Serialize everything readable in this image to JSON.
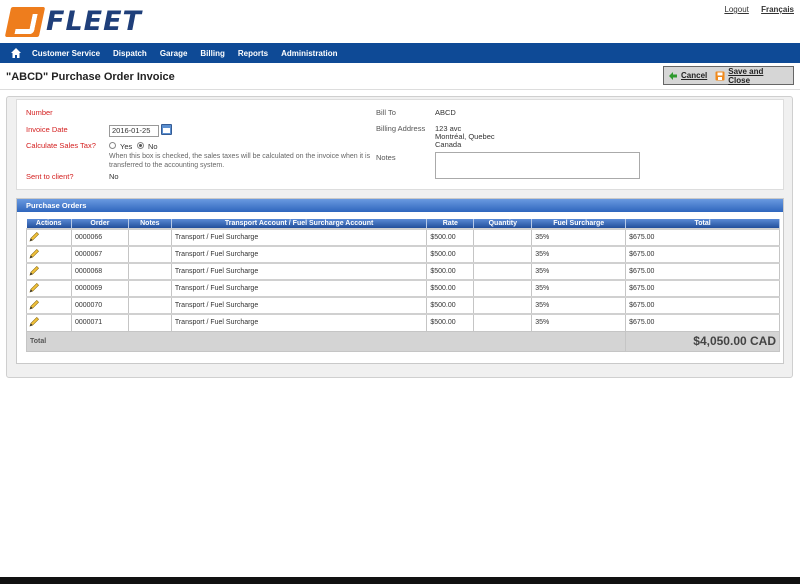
{
  "brand": {
    "logo_text": "FLEET",
    "accent_color": "#ee7d1d",
    "nav_color": "#0e4a96"
  },
  "top_links": {
    "logout": "Logout",
    "language": "Français"
  },
  "nav": {
    "home_icon": "home-icon",
    "items": [
      "Customer Service",
      "Dispatch",
      "Garage",
      "Billing",
      "Reports",
      "Administration"
    ]
  },
  "page": {
    "title": "\"ABCD\" Purchase Order Invoice"
  },
  "actions": {
    "cancel": "Cancel",
    "save_close": "Save and Close"
  },
  "form": {
    "number_label": "Number",
    "invoice_date_label": "Invoice Date",
    "invoice_date_value": "2016-01-25",
    "sales_tax_label": "Calculate Sales Tax?",
    "yes_label": "Yes",
    "no_label": "No",
    "sales_tax_selected": "No",
    "sales_tax_help": "When this box is checked, the sales taxes will be calculated on the invoice when it is transferred to the accounting system.",
    "sent_label": "Sent to client?",
    "sent_value": "No",
    "bill_to_label": "Bill To",
    "bill_to_value": "ABCD",
    "billing_address_label": "Billing Address",
    "billing_address_line1": "123 avc",
    "billing_address_line2": "Montréal, Quebec",
    "billing_address_line3": "Canada",
    "notes_label": "Notes",
    "notes_value": ""
  },
  "purchase_orders": {
    "section_title": "Purchase Orders",
    "columns": [
      "Actions",
      "Order",
      "Notes",
      "Transport Account / Fuel Surcharge Account",
      "Rate",
      "Quantity",
      "Fuel Surcharge",
      "Total"
    ],
    "rows": [
      {
        "order": "0000066",
        "notes": "",
        "account": "Transport / Fuel Surcharge",
        "rate": "$500.00",
        "quantity": "",
        "fuel_surcharge": "35%",
        "total": "$675.00"
      },
      {
        "order": "0000067",
        "notes": "",
        "account": "Transport / Fuel Surcharge",
        "rate": "$500.00",
        "quantity": "",
        "fuel_surcharge": "35%",
        "total": "$675.00"
      },
      {
        "order": "0000068",
        "notes": "",
        "account": "Transport / Fuel Surcharge",
        "rate": "$500.00",
        "quantity": "",
        "fuel_surcharge": "35%",
        "total": "$675.00"
      },
      {
        "order": "0000069",
        "notes": "",
        "account": "Transport / Fuel Surcharge",
        "rate": "$500.00",
        "quantity": "",
        "fuel_surcharge": "35%",
        "total": "$675.00"
      },
      {
        "order": "0000070",
        "notes": "",
        "account": "Transport / Fuel Surcharge",
        "rate": "$500.00",
        "quantity": "",
        "fuel_surcharge": "35%",
        "total": "$675.00"
      },
      {
        "order": "0000071",
        "notes": "",
        "account": "Transport / Fuel Surcharge",
        "rate": "$500.00",
        "quantity": "",
        "fuel_surcharge": "35%",
        "total": "$675.00"
      }
    ],
    "total_label": "Total",
    "total_value": "$4,050.00 CAD"
  }
}
